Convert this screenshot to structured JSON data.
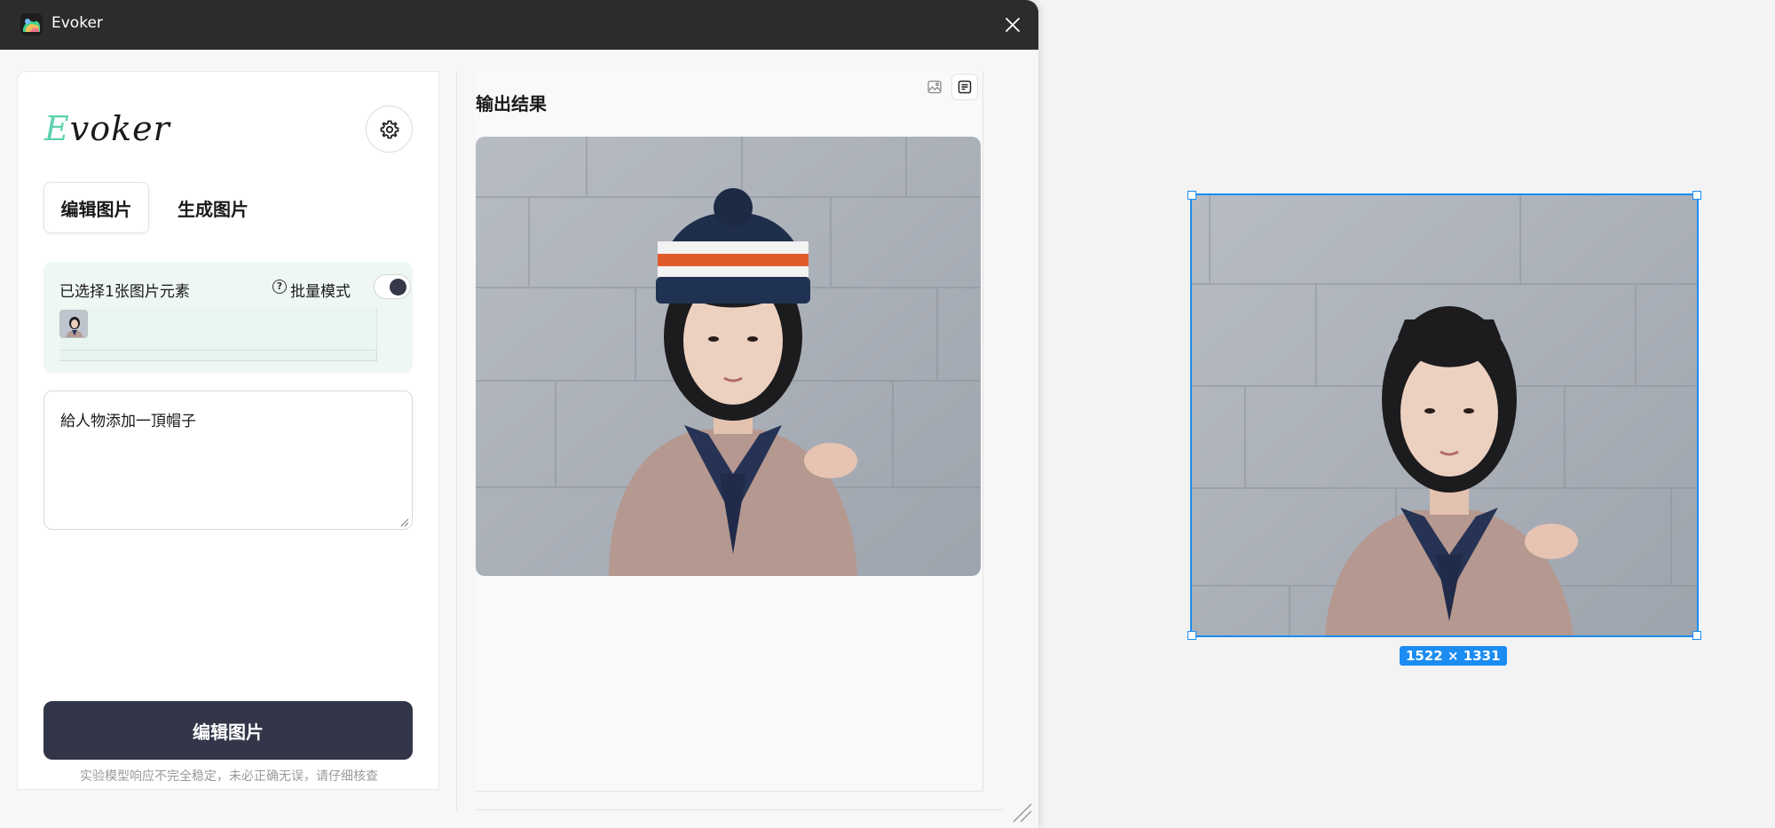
{
  "titlebar": {
    "title": "Evoker",
    "icon": "app-icon",
    "close_icon": "close-icon"
  },
  "logo": {
    "first_letter": "E",
    "rest": "voker",
    "accent_color": "#5fd1b0"
  },
  "tabs": [
    {
      "label": "编辑图片",
      "active": true
    },
    {
      "label": "生成图片",
      "active": false
    }
  ],
  "selection": {
    "label": "已选择1张图片元素",
    "batch_mode_label": "批量模式",
    "batch_mode_on": true
  },
  "prompt": {
    "value": "給人物添加一頂帽子"
  },
  "primary_button": {
    "label": "编辑图片",
    "color": "#333648"
  },
  "disclaimer": "实验模型响应不完全稳定，未必正确无误，请仔细核查",
  "output": {
    "title": "输出结果",
    "view_buttons": [
      "image-view-icon",
      "text-view-icon"
    ]
  },
  "canvas": {
    "size_label": "1522 × 1331",
    "selection_color": "#1b8cf2"
  }
}
